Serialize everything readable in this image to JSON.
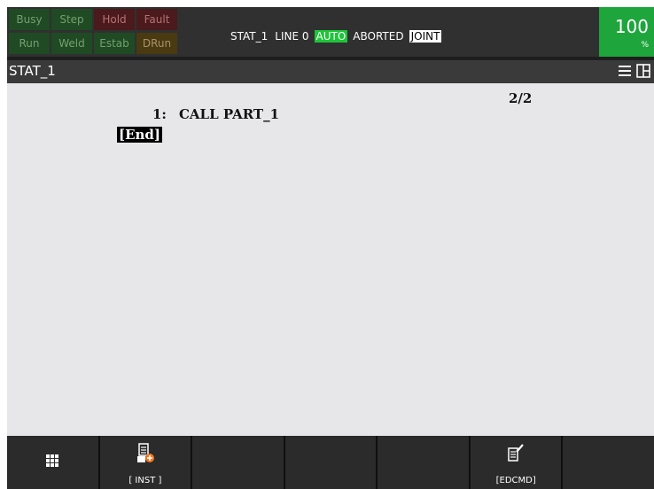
{
  "status_flags": {
    "row1": [
      "Busy",
      "Step",
      "Hold",
      "Fault"
    ],
    "row2": [
      "Run",
      "Weld",
      "Estab",
      "DRun"
    ]
  },
  "status_message": {
    "program": "STAT_1",
    "line": "LINE 0",
    "mode": "AUTO",
    "state": "ABORTED",
    "frame": "JOINT"
  },
  "override": {
    "value": "100",
    "unit": "%"
  },
  "title_bar": {
    "title": "STAT_1",
    "icons": [
      "menu-icon",
      "split-view-icon"
    ]
  },
  "editor": {
    "page": "2/2",
    "lines": [
      {
        "number": "1:",
        "code": "CALL PART_1"
      }
    ],
    "end_marker": "[End]"
  },
  "function_keys": [
    {
      "label": "",
      "icon": "grid-menu-icon"
    },
    {
      "label": "[ INST ]",
      "icon": "instruction-add-icon"
    },
    {
      "label": "",
      "icon": ""
    },
    {
      "label": "",
      "icon": ""
    },
    {
      "label": "",
      "icon": ""
    },
    {
      "label": "[EDCMD]",
      "icon": "edit-command-icon"
    },
    {
      "label": "",
      "icon": ""
    }
  ],
  "colors": {
    "auto_highlight": "#1ec43a",
    "override_bg": "#1ea63c",
    "editor_bg": "#e7e7ea"
  }
}
